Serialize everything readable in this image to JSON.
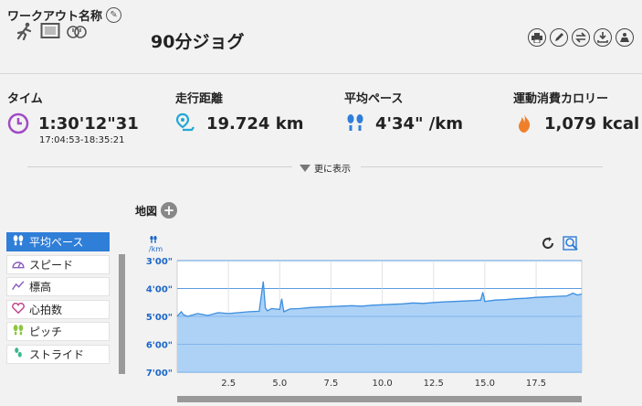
{
  "header": {
    "title": "ワークアウト名称",
    "workout_name": "90分ジョグ"
  },
  "stats": {
    "time": {
      "label": "タイム",
      "value": "1:30'12\"31",
      "range": "17:04:53-18:35:21"
    },
    "distance": {
      "label": "走行距離",
      "value": "19.724 km"
    },
    "avg_pace": {
      "label": "平均ペース",
      "value": "4'34\" /km"
    },
    "calories": {
      "label": "運動消費カロリー",
      "value": "1,079 kcal"
    }
  },
  "more_label": "更に表示",
  "map_label": "地図",
  "side_items": [
    {
      "label": "平均ペース",
      "icon": "footprints-icon",
      "active": true
    },
    {
      "label": "スピード",
      "icon": "speedometer-icon",
      "active": false
    },
    {
      "label": "標高",
      "icon": "elevation-icon",
      "active": false
    },
    {
      "label": "心拍数",
      "icon": "heart-icon",
      "active": false
    },
    {
      "label": "ピッチ",
      "icon": "footprints-icon",
      "active": false
    },
    {
      "label": "ストライド",
      "icon": "stride-icon",
      "active": false
    }
  ],
  "chart_unit": "/km",
  "colors": {
    "accent": "#2f7ed8",
    "area_fill": "#a9d0f5",
    "line": "#3d8fe0",
    "axis_text": "#1b66c9",
    "time_icon": "#a04bc6",
    "distance_icon": "#22a8d8",
    "calorie_icon": "#f07f2c"
  },
  "chart_data": {
    "type": "area",
    "title": "",
    "xlabel": "",
    "ylabel": "/km",
    "y_ticks": [
      "3'00\"",
      "4'00\"",
      "5'00\"",
      "6'00\"",
      "7'00\""
    ],
    "y_tick_seconds": [
      180,
      240,
      300,
      360,
      420
    ],
    "ylim": [
      180,
      420
    ],
    "y_inverted": true,
    "x_ticks": [
      "2.5",
      "5.0",
      "7.5",
      "10.0",
      "12.5",
      "15.0",
      "17.5"
    ],
    "x_tick_values": [
      2.5,
      5.0,
      7.5,
      10.0,
      12.5,
      15.0,
      17.5
    ],
    "xlim": [
      0,
      19.724
    ],
    "series": [
      {
        "x": [
          0,
          0.2,
          0.3,
          0.5,
          1.0,
          1.5,
          2.0,
          2.5,
          3.0,
          3.5,
          4.0,
          4.2,
          4.3,
          4.4,
          4.6,
          5.0,
          5.1,
          5.2,
          5.5,
          6.0,
          6.5,
          7.0,
          7.5,
          8.0,
          8.5,
          9.0,
          9.5,
          10.0,
          10.5,
          11.0,
          11.5,
          12.0,
          12.5,
          13.0,
          13.5,
          14.0,
          14.5,
          14.8,
          14.9,
          15.0,
          15.5,
          16.0,
          16.5,
          17.0,
          17.5,
          18.0,
          18.5,
          19.0,
          19.3,
          19.5,
          19.724
        ],
        "y": [
          300,
          290,
          296,
          300,
          294,
          298,
          292,
          294,
          292,
          290,
          289,
          225,
          282,
          288,
          283,
          285,
          262,
          290,
          284,
          283,
          281,
          280,
          279,
          278,
          277,
          278,
          276,
          275,
          274,
          273,
          271,
          272,
          270,
          269,
          268,
          267,
          266,
          265,
          248,
          268,
          265,
          264,
          262,
          261,
          259,
          258,
          257,
          256,
          250,
          254,
          252
        ]
      }
    ]
  }
}
